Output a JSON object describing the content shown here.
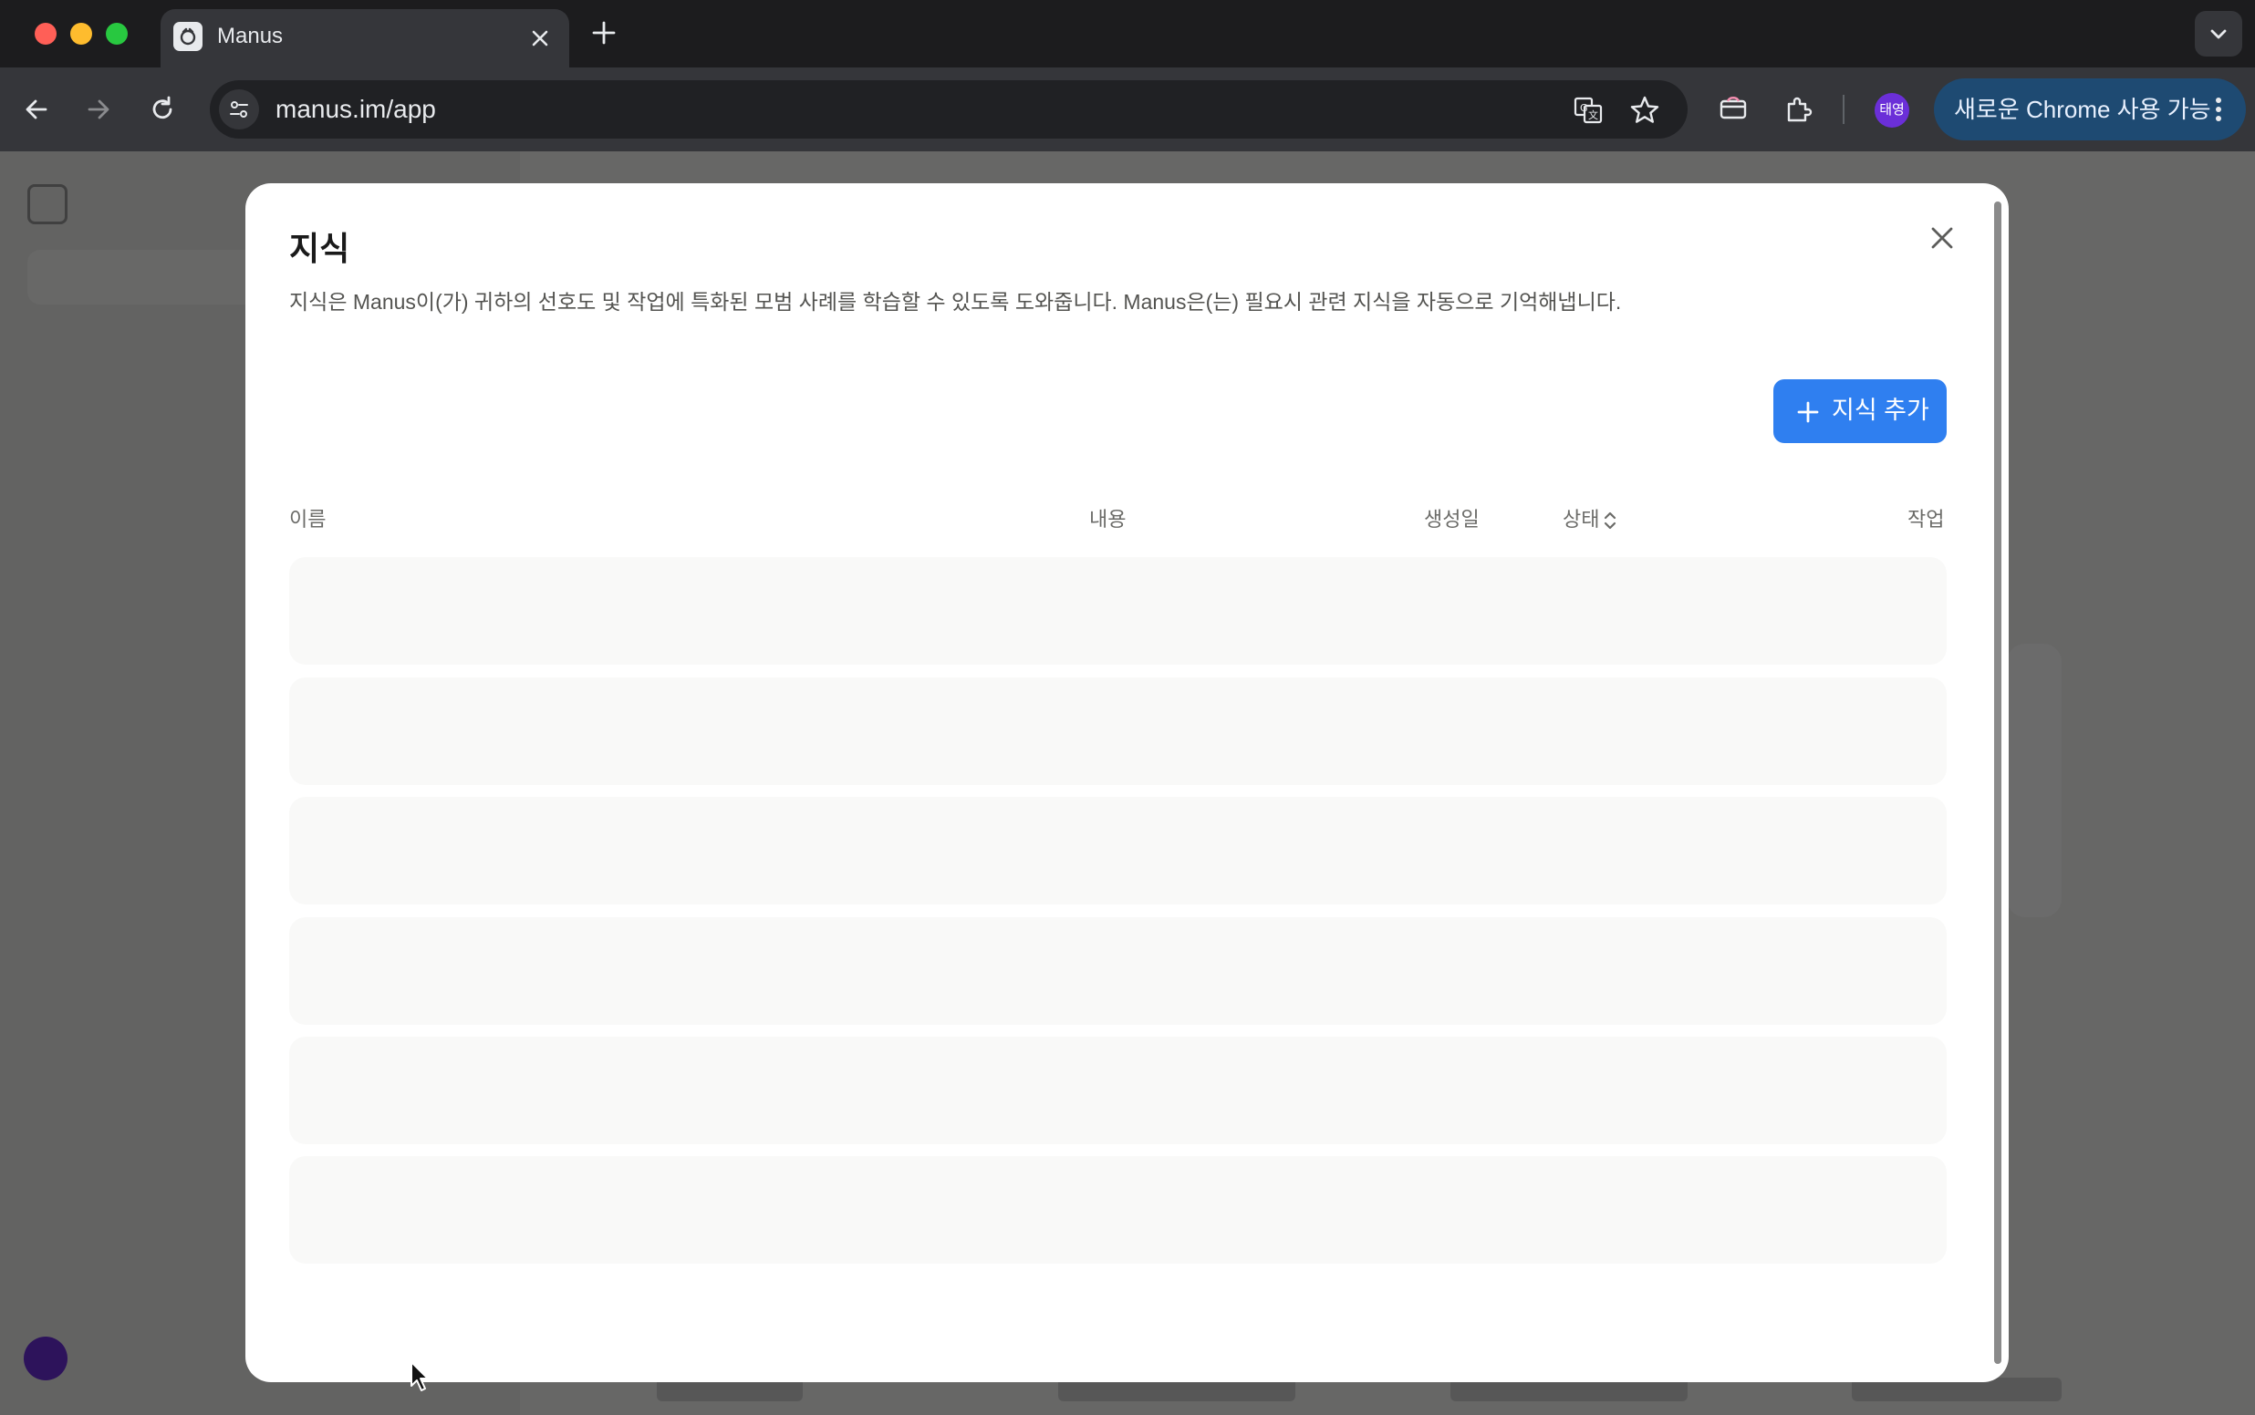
{
  "browser": {
    "tab_title": "Manus",
    "url": "manus.im/app",
    "profile_initials": "태영",
    "update_label": "새로운 Chrome 사용 가능"
  },
  "modal": {
    "title": "지식",
    "description": "지식은 Manus이(가) 귀하의 선호도 및 작업에 특화된 모범 사례를 학습할 수 있도록 도와줍니다. Manus은(는) 필요시 관련 지식을 자동으로 기억해냅니다.",
    "add_button_label": "지식 추가",
    "columns": {
      "name": "이름",
      "content": "내용",
      "created": "생성일",
      "status": "상태",
      "actions": "작업"
    },
    "loading_rows": 6
  },
  "colors": {
    "accent": "#2f7ff0",
    "skeleton": "#f9f9f8",
    "profile": "#6b2fd8"
  }
}
